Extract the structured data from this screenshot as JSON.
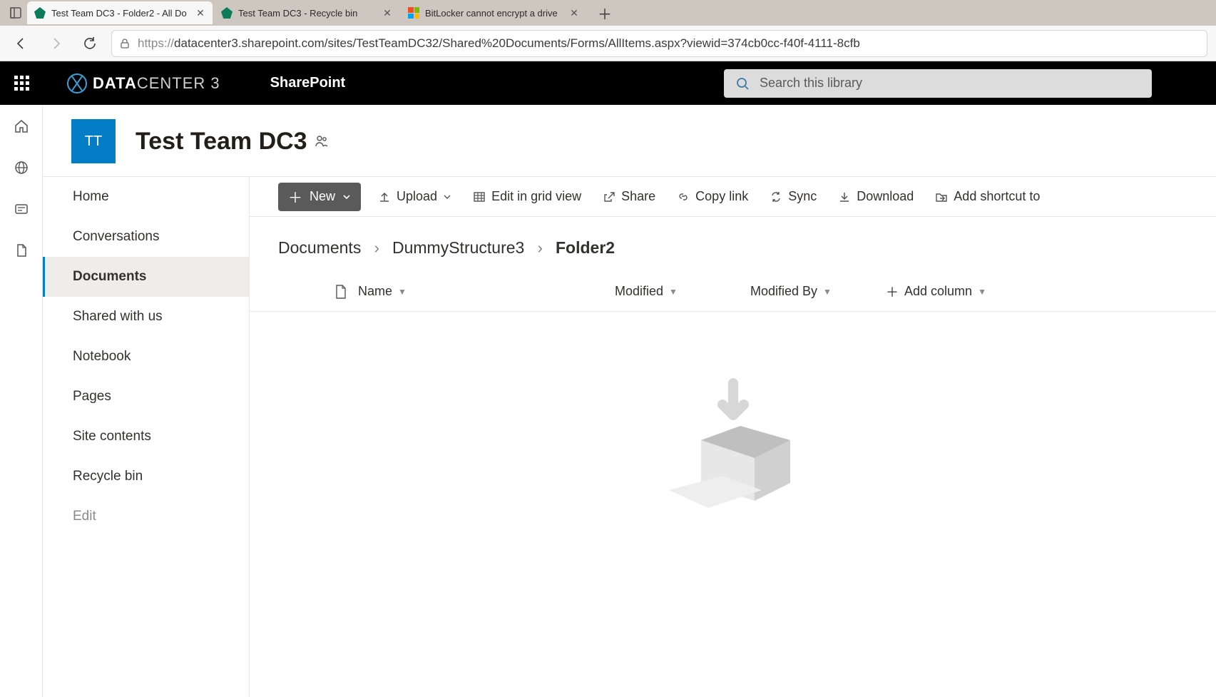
{
  "browser": {
    "tabs": [
      {
        "title": "Test Team DC3 - Folder2 - All Do",
        "favicon": "sp",
        "active": true
      },
      {
        "title": "Test Team DC3 - Recycle bin",
        "favicon": "sp",
        "active": false
      },
      {
        "title": "BitLocker cannot encrypt a drive",
        "favicon": "edge",
        "active": false
      }
    ],
    "url_proto": "https://",
    "url_rest": "datacenter3.sharepoint.com/sites/TestTeamDC32/Shared%20Documents/Forms/AllItems.aspx?viewid=374cb0cc-f40f-4111-8cfb"
  },
  "suite": {
    "brand_main": "DATA",
    "brand_thin": "CENTER 3",
    "product": "SharePoint",
    "search_placeholder": "Search this library"
  },
  "site": {
    "avatar_initials": "TT",
    "title": "Test Team DC3"
  },
  "left_nav": {
    "items": [
      {
        "label": "Home"
      },
      {
        "label": "Conversations"
      },
      {
        "label": "Documents",
        "active": true
      },
      {
        "label": "Shared with us"
      },
      {
        "label": "Notebook"
      },
      {
        "label": "Pages"
      },
      {
        "label": "Site contents"
      },
      {
        "label": "Recycle bin"
      },
      {
        "label": "Edit",
        "dimmed": true
      }
    ]
  },
  "cmd_bar": {
    "new_label": "New",
    "upload": "Upload",
    "edit_grid": "Edit in grid view",
    "share": "Share",
    "copy_link": "Copy link",
    "sync": "Sync",
    "download": "Download",
    "add_shortcut": "Add shortcut to"
  },
  "breadcrumb": {
    "items": [
      {
        "label": "Documents"
      },
      {
        "label": "DummyStructure3"
      },
      {
        "label": "Folder2",
        "current": true
      }
    ]
  },
  "columns": {
    "name": "Name",
    "modified": "Modified",
    "modified_by": "Modified By",
    "add_column": "Add column"
  }
}
